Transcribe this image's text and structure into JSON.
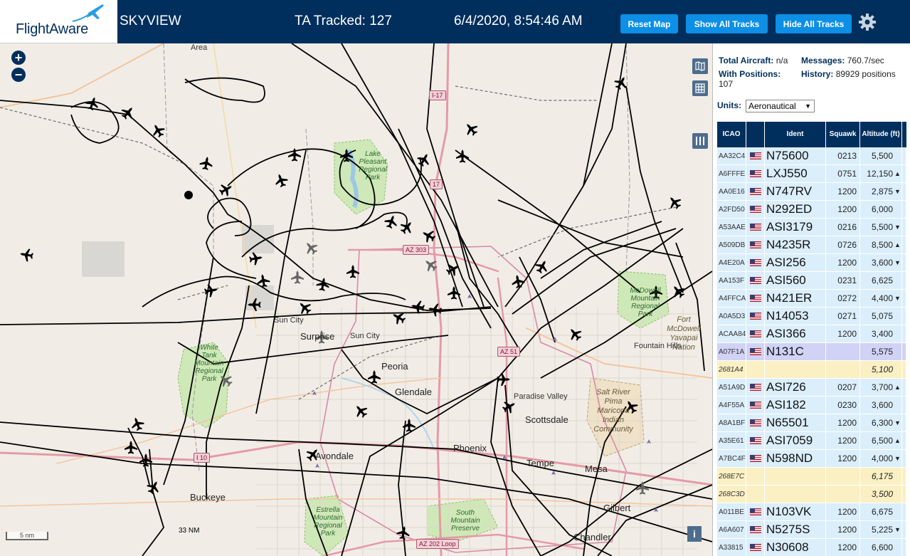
{
  "header": {
    "logo_text": "FlightAware",
    "title": "SKYVIEW",
    "tracked": "TA Tracked: 127",
    "datetime": "6/4/2020, 8:54:46 AM",
    "reset_label": "Reset Map",
    "show_label": "Show All Tracks",
    "hide_label": "Hide All Tracks"
  },
  "map": {
    "zoom_in": "+",
    "zoom_out": "−",
    "scale": "5 nm",
    "range": "33 NM",
    "info": "i",
    "labels": {
      "area": "Area",
      "i17": "I-17",
      "n17": "17",
      "az303": "AZ 303",
      "az51": "AZ 51",
      "i10": "I 10",
      "az202": "AZ 202 Loop",
      "sun_city_west": "Sun City",
      "sun_city": "Sun City",
      "surprise": "Surprise",
      "peoria": "Peoria",
      "glendale": "Glendale",
      "paradise_valley": "Paradise Valley",
      "scottsdale": "Scottsdale",
      "phoenix": "Phoenix",
      "avondale": "Avondale",
      "tempe": "Tempe",
      "mesa": "Mesa",
      "gilbert": "Gilbert",
      "chandler": "Chandler",
      "buckeye": "Buckeye",
      "fountain_hills": "Fountain Hills",
      "lake_pleasant": "Lake Pleasant Regional Park",
      "white_tank": "White Tank Mountain Regional Park",
      "mcdowell": "McDowell Mountain Regional Park",
      "fort_mcdowell": "Fort McDowell Yavapai Nation",
      "salt_river": "Salt River Pima Maricopa Indian Community",
      "south_mountain": "South Mountain Preserve",
      "estrella": "Estrella Mountain Regional Park"
    }
  },
  "stats": {
    "total_label": "Total Aircraft:",
    "total_value": "n/a",
    "messages_label": "Messages:",
    "messages_value": "760.7/sec",
    "positions_label": "With Positions:",
    "positions_value": "107",
    "history_label": "History:",
    "history_value": "89929 positions"
  },
  "units": {
    "label": "Units:",
    "selected": "Aeronautical"
  },
  "table": {
    "headers": {
      "icao": "ICAO",
      "ident": "Ident",
      "squawk": "Squawk",
      "altitude": "Altitude (ft)"
    },
    "rows": [
      {
        "icao": "AA32C4",
        "flag": true,
        "ident": "N75600",
        "squawk": "0213",
        "alt": "5,500",
        "trend": "",
        "style": "blue"
      },
      {
        "icao": "A6FFFE",
        "flag": true,
        "ident": "LXJ550",
        "squawk": "0751",
        "alt": "12,150",
        "trend": "▲",
        "style": "blue"
      },
      {
        "icao": "AA0E16",
        "flag": true,
        "ident": "N747RV",
        "squawk": "1200",
        "alt": "2,875",
        "trend": "▼",
        "style": "blue"
      },
      {
        "icao": "A2FD50",
        "flag": true,
        "ident": "N292ED",
        "squawk": "1200",
        "alt": "6,000",
        "trend": "",
        "style": "blue"
      },
      {
        "icao": "A53AAE",
        "flag": true,
        "ident": "ASI3179",
        "squawk": "0216",
        "alt": "5,500",
        "trend": "▼",
        "style": "blue"
      },
      {
        "icao": "A509DB",
        "flag": true,
        "ident": "N4235R",
        "squawk": "0726",
        "alt": "8,500",
        "trend": "▲",
        "style": "blue"
      },
      {
        "icao": "A4E20A",
        "flag": true,
        "ident": "ASI256",
        "squawk": "1200",
        "alt": "3,600",
        "trend": "▼",
        "style": "blue"
      },
      {
        "icao": "AA153F",
        "flag": true,
        "ident": "ASI560",
        "squawk": "0231",
        "alt": "6,625",
        "trend": "",
        "style": "blue"
      },
      {
        "icao": "A4FFCA",
        "flag": true,
        "ident": "N421ER",
        "squawk": "0272",
        "alt": "4,400",
        "trend": "▼",
        "style": "blue"
      },
      {
        "icao": "A0A5D3",
        "flag": true,
        "ident": "N14053",
        "squawk": "0271",
        "alt": "5,075",
        "trend": "",
        "style": "blue"
      },
      {
        "icao": "ACAA84",
        "flag": true,
        "ident": "ASI366",
        "squawk": "1200",
        "alt": "3,400",
        "trend": "",
        "style": "blue"
      },
      {
        "icao": "A07F1A",
        "flag": true,
        "ident": "N131C",
        "squawk": "",
        "alt": "5,575",
        "trend": "",
        "style": "selected"
      },
      {
        "icao": "2681A4",
        "flag": false,
        "ident": "",
        "squawk": "",
        "alt": "5,100",
        "trend": "",
        "style": "yellow"
      },
      {
        "icao": "A51A9D",
        "flag": true,
        "ident": "ASI726",
        "squawk": "0207",
        "alt": "3,700",
        "trend": "▲",
        "style": "blue"
      },
      {
        "icao": "A4F55A",
        "flag": true,
        "ident": "ASI182",
        "squawk": "0230",
        "alt": "3,600",
        "trend": "",
        "style": "blue"
      },
      {
        "icao": "A8A1BF",
        "flag": true,
        "ident": "N65501",
        "squawk": "1200",
        "alt": "6,300",
        "trend": "▼",
        "style": "blue"
      },
      {
        "icao": "A35E61",
        "flag": true,
        "ident": "ASI7059",
        "squawk": "1200",
        "alt": "6,500",
        "trend": "▲",
        "style": "blue"
      },
      {
        "icao": "A7BC4F",
        "flag": true,
        "ident": "N598ND",
        "squawk": "1200",
        "alt": "4,000",
        "trend": "▼",
        "style": "blue"
      },
      {
        "icao": "268E7C",
        "flag": false,
        "ident": "",
        "squawk": "",
        "alt": "6,175",
        "trend": "",
        "style": "yellow"
      },
      {
        "icao": "268C3D",
        "flag": false,
        "ident": "",
        "squawk": "",
        "alt": "3,500",
        "trend": "",
        "style": "yellow"
      },
      {
        "icao": "A011BE",
        "flag": true,
        "ident": "N103VK",
        "squawk": "1200",
        "alt": "6,675",
        "trend": "",
        "style": "blue"
      },
      {
        "icao": "A6A607",
        "flag": true,
        "ident": "N5275S",
        "squawk": "1200",
        "alt": "5,225",
        "trend": "▼",
        "style": "blue"
      },
      {
        "icao": "A33815",
        "flag": true,
        "ident": "N30608",
        "squawk": "1200",
        "alt": "6,600",
        "trend": "",
        "style": "blue"
      }
    ]
  },
  "colors": {
    "header_bg": "#002f5d",
    "button_bg": "#0d8fe6",
    "row_blue": "#dbeefb",
    "row_yellow": "#fbf0c3",
    "row_selected": "#d0d2f6",
    "park_green": "#cfe8b8",
    "track": "#000000"
  },
  "icons": {
    "gear": "gear-icon",
    "logo": "plane-logo-icon",
    "map_layers": "map-icon",
    "grid": "grid-icon",
    "columns": "columns-icon",
    "aircraft": "aircraft-icon"
  }
}
